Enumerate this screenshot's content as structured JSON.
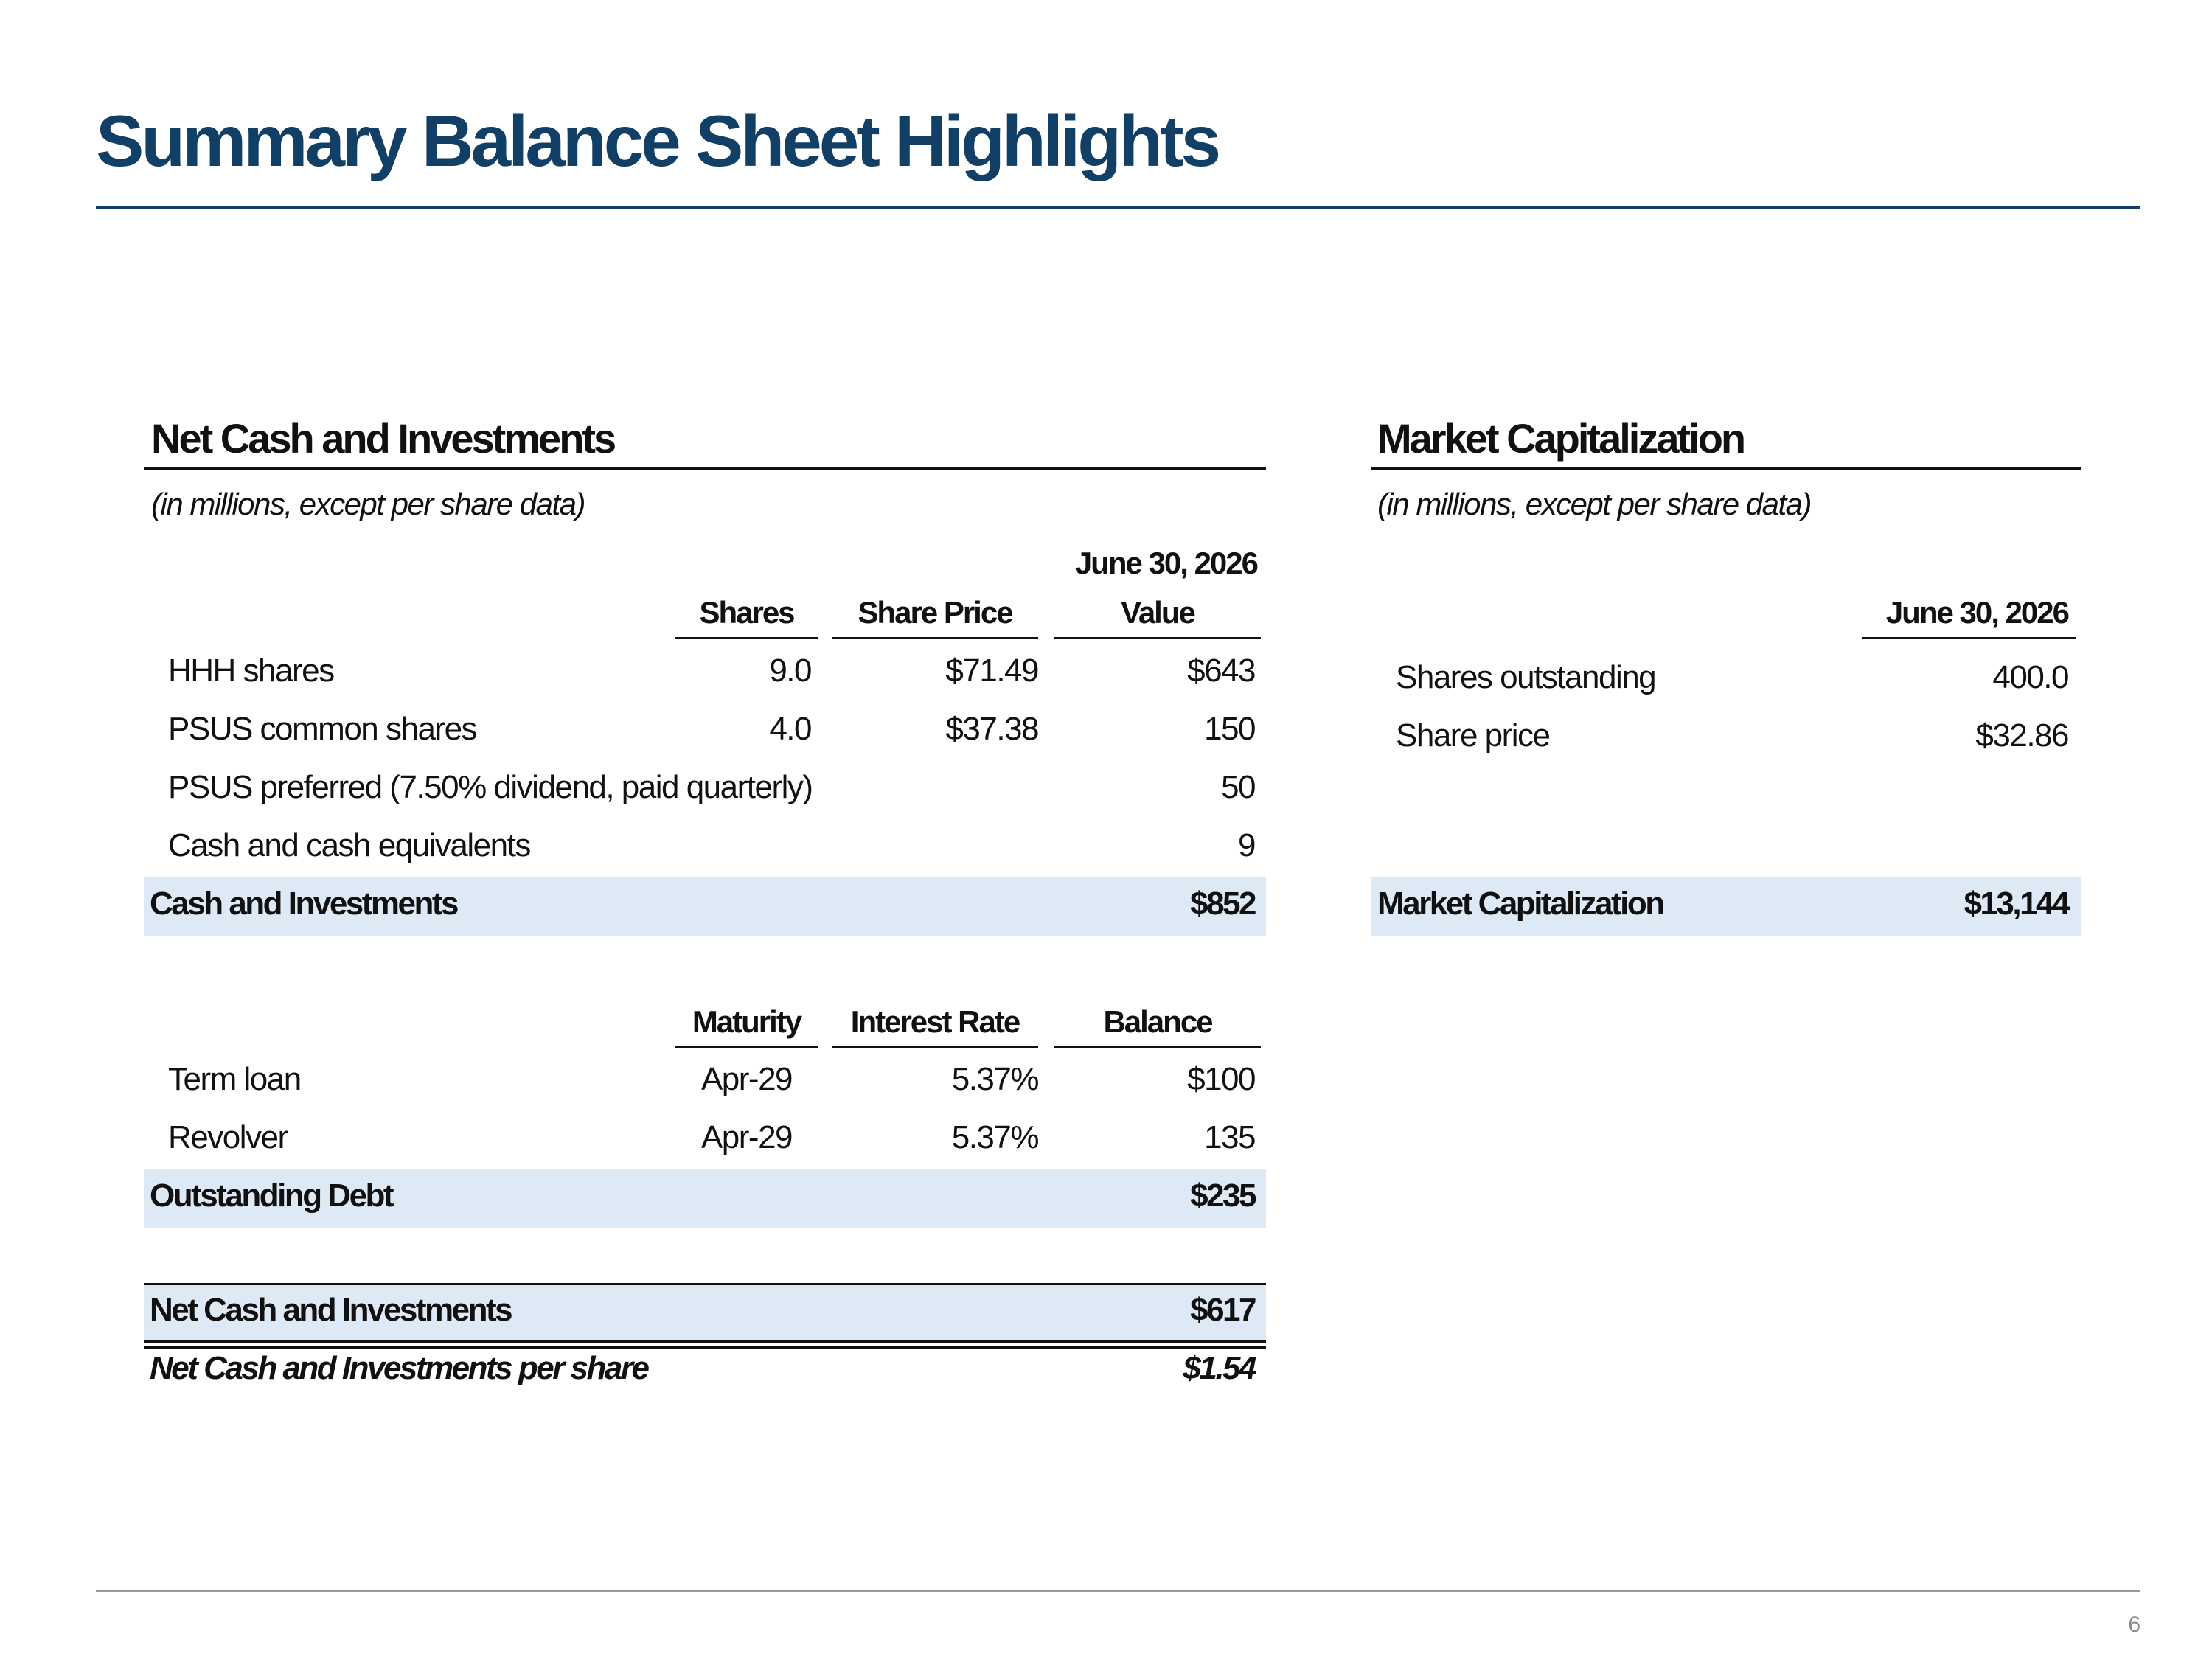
{
  "page": {
    "title": "Summary Balance Sheet Highlights",
    "page_number": "6"
  },
  "net_cash": {
    "title": "Net Cash and Investments",
    "subtitle": "(in millions, except per share data)",
    "headers": {
      "date": "June 30, 2026",
      "shares": "Shares",
      "share_price": "Share Price",
      "value": "Value"
    },
    "rows": [
      {
        "label": "HHH shares",
        "shares": "9.0",
        "price": "$71.49",
        "value": "$643"
      },
      {
        "label": "PSUS common shares",
        "shares": "4.0",
        "price": "$37.38",
        "value": "150"
      },
      {
        "label": "PSUS preferred (7.50% dividend, paid quarterly)",
        "shares": "",
        "price": "",
        "value": "50"
      },
      {
        "label": "Cash and cash equivalents",
        "shares": "",
        "price": "",
        "value": "9"
      }
    ],
    "total": {
      "label": "Cash and Investments",
      "value": "$852"
    },
    "debt_headers": {
      "maturity": "Maturity",
      "interest_rate": "Interest Rate",
      "balance": "Balance"
    },
    "debt_rows": [
      {
        "label": "Term loan",
        "maturity": "Apr-29",
        "rate": "5.37%",
        "balance": "$100"
      },
      {
        "label": "Revolver",
        "maturity": "Apr-29",
        "rate": "5.37%",
        "balance": "135"
      }
    ],
    "debt_total": {
      "label": "Outstanding Debt",
      "value": "$235"
    },
    "net_total": {
      "label": "Net Cash and Investments",
      "value": "$617"
    },
    "per_share": {
      "label": "Net Cash and Investments per share",
      "value": "$1.54"
    }
  },
  "market_cap": {
    "title": "Market Capitalization",
    "subtitle": "(in millions, except per share data)",
    "date_header": "June 30, 2026",
    "rows": [
      {
        "label": "Shares outstanding",
        "value": "400.0"
      },
      {
        "label": "Share price",
        "value": "$32.86"
      }
    ],
    "total": {
      "label": "Market Capitalization",
      "value": "$13,144"
    }
  },
  "colors": {
    "title": "#123f66",
    "band": "#dde9f4",
    "footer_rule": "#9a9a9a"
  }
}
